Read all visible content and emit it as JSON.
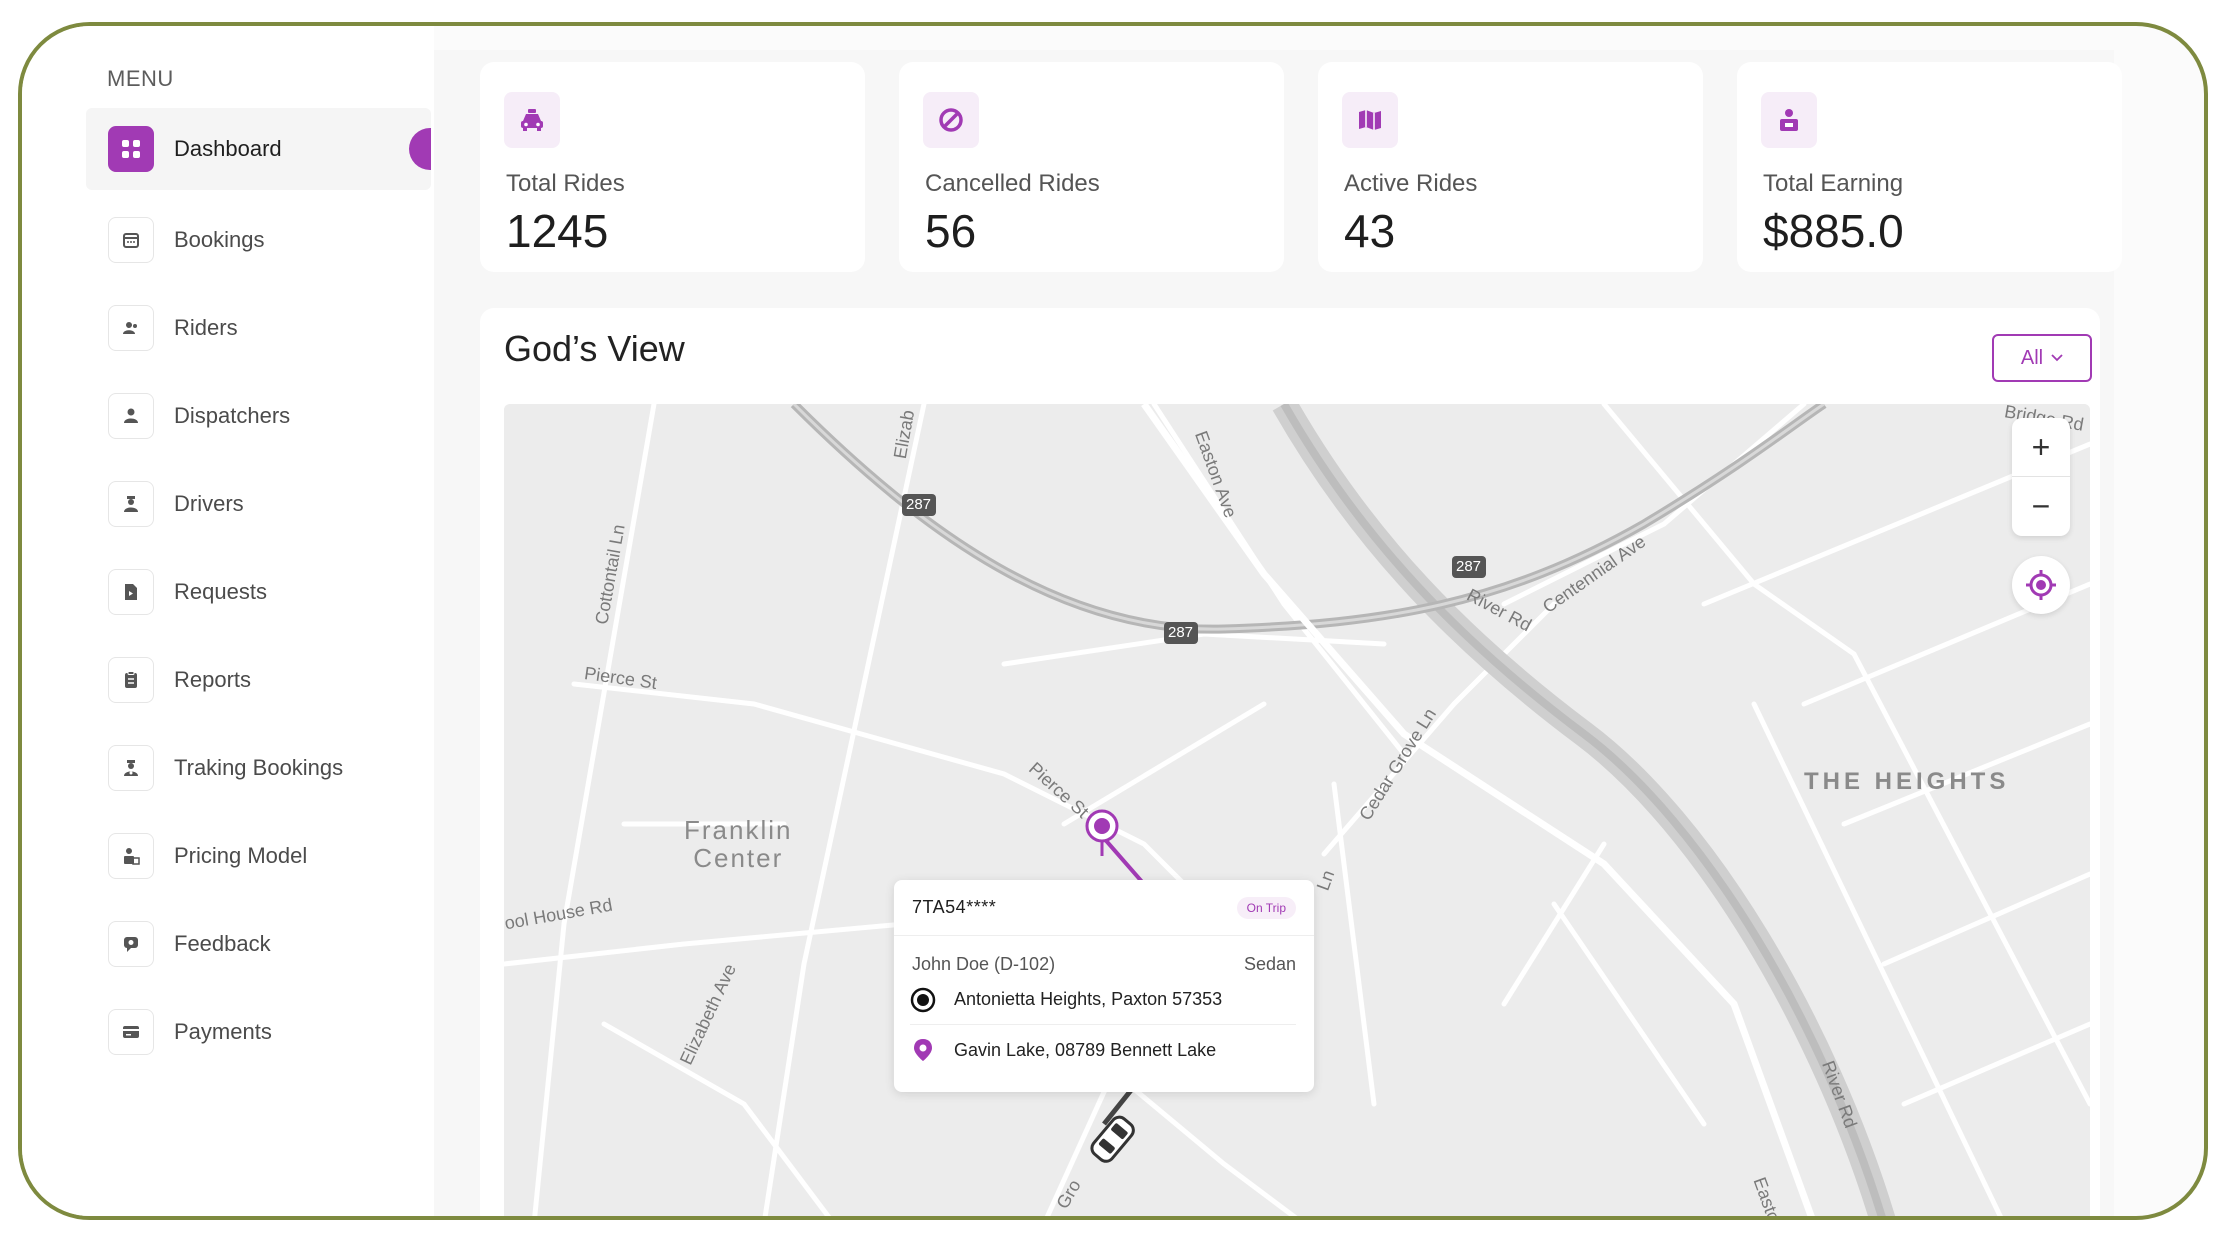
{
  "sidebar": {
    "menu_title": "MENU",
    "items": [
      {
        "label": "Dashboard",
        "icon": "dashboard-grid-icon",
        "active": true
      },
      {
        "label": "Bookings",
        "icon": "calendar-icon"
      },
      {
        "label": "Riders",
        "icon": "users-icon"
      },
      {
        "label": "Dispatchers",
        "icon": "person-icon"
      },
      {
        "label": "Drivers",
        "icon": "driver-icon"
      },
      {
        "label": "Requests",
        "icon": "document-icon"
      },
      {
        "label": "Reports",
        "icon": "clipboard-icon"
      },
      {
        "label": "Traking Bookings",
        "icon": "tracking-icon"
      },
      {
        "label": "Pricing Model",
        "icon": "pricing-icon"
      },
      {
        "label": "Feedback",
        "icon": "feedback-icon"
      },
      {
        "label": "Payments",
        "icon": "card-icon"
      }
    ]
  },
  "stats": [
    {
      "label": "Total Rides",
      "value": "1245",
      "icon": "taxi-icon"
    },
    {
      "label": "Cancelled Rides",
      "value": "56",
      "icon": "cancel-icon"
    },
    {
      "label": "Active Rides",
      "value": "43",
      "icon": "map-icon"
    },
    {
      "label": "Total Earning",
      "value": "$885.0",
      "icon": "earning-icon"
    }
  ],
  "gods_view": {
    "title": "God’s View",
    "filter": {
      "selected": "All"
    }
  },
  "map": {
    "labels": {
      "pierce_st": "Pierce St",
      "pierce_st2": "Pierce St",
      "cottontail": "Cottontail Ln",
      "elizabeth": "Elizab",
      "elizabeth_ave": "Elizabeth Ave",
      "easton": "Easton Ave",
      "easton2": "Easton",
      "river_rd": "River Rd",
      "river_rd2": "River Rd",
      "centennial": "Centennial Ave",
      "bridge_rd": "Bridge Rd",
      "cedar_grove": "Cedar Grove Ln",
      "school_house": "ool House Rd",
      "ln": "Ln",
      "gro": "Gro",
      "hw1": "287",
      "hw2": "287",
      "hw3": "287",
      "franklin_center": "Franklin\nCenter",
      "the_heights": "THE HEIGHTS"
    },
    "zoom_in": "+",
    "zoom_out": "−"
  },
  "trip_popup": {
    "plate": "7TA54****",
    "status": "On Trip",
    "driver": "John Doe (D-102)",
    "vehicle": "Sedan",
    "pickup": "Antonietta Heights, Paxton 57353",
    "dropoff": "Gavin Lake, 08789 Bennett Lake"
  },
  "colors": {
    "accent": "#a13ab4",
    "frame": "#7e8a3f"
  }
}
